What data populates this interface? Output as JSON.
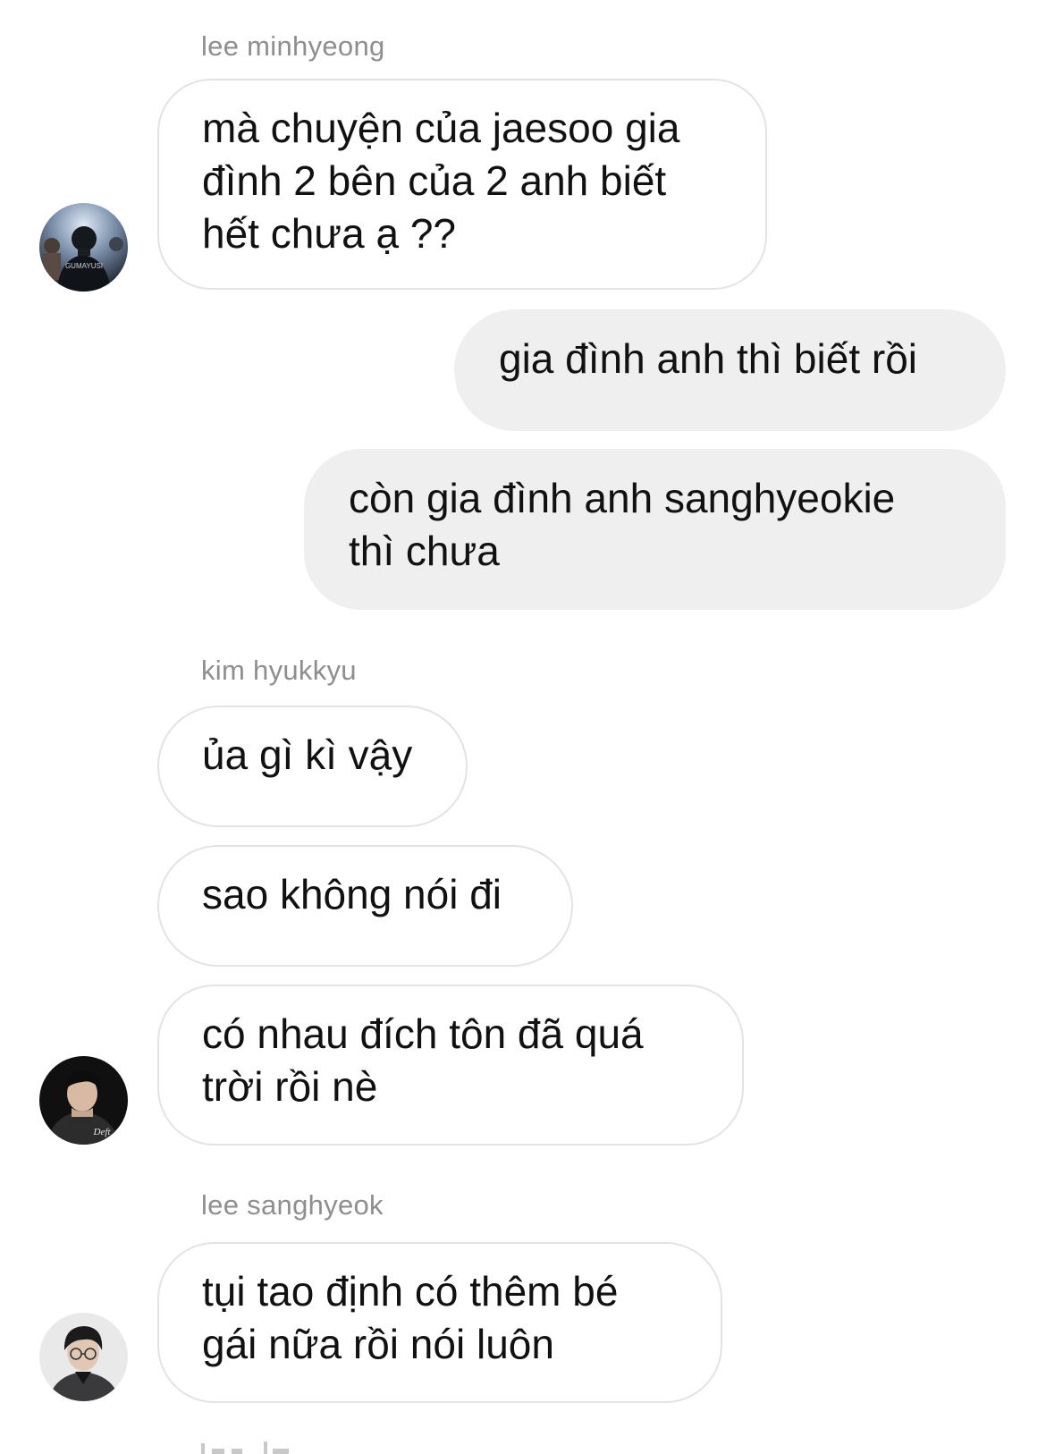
{
  "messages": [
    {
      "sender_name": "lee minhyeong",
      "text": "mà chuyện của jaesoo gia\nđình 2 bên của 2 anh biết\nhết chưa ạ ??",
      "avatar_label": "GUMAYUSI"
    },
    {
      "text": "gia đình anh thì biết rồi"
    },
    {
      "text": "còn gia đình anh sanghyeokie\nthì chưa"
    },
    {
      "sender_name": "kim hyukkyu",
      "text": "ủa gì kì vậy"
    },
    {
      "text": "sao không nói đi"
    },
    {
      "text": "có nhau đích tôn đã quá\ntrời rồi nè",
      "avatar_label": "Deft"
    },
    {
      "sender_name": "lee sanghyeok",
      "text": "tụi tao định có thêm bé\ngái nữa rồi nói luôn"
    }
  ]
}
